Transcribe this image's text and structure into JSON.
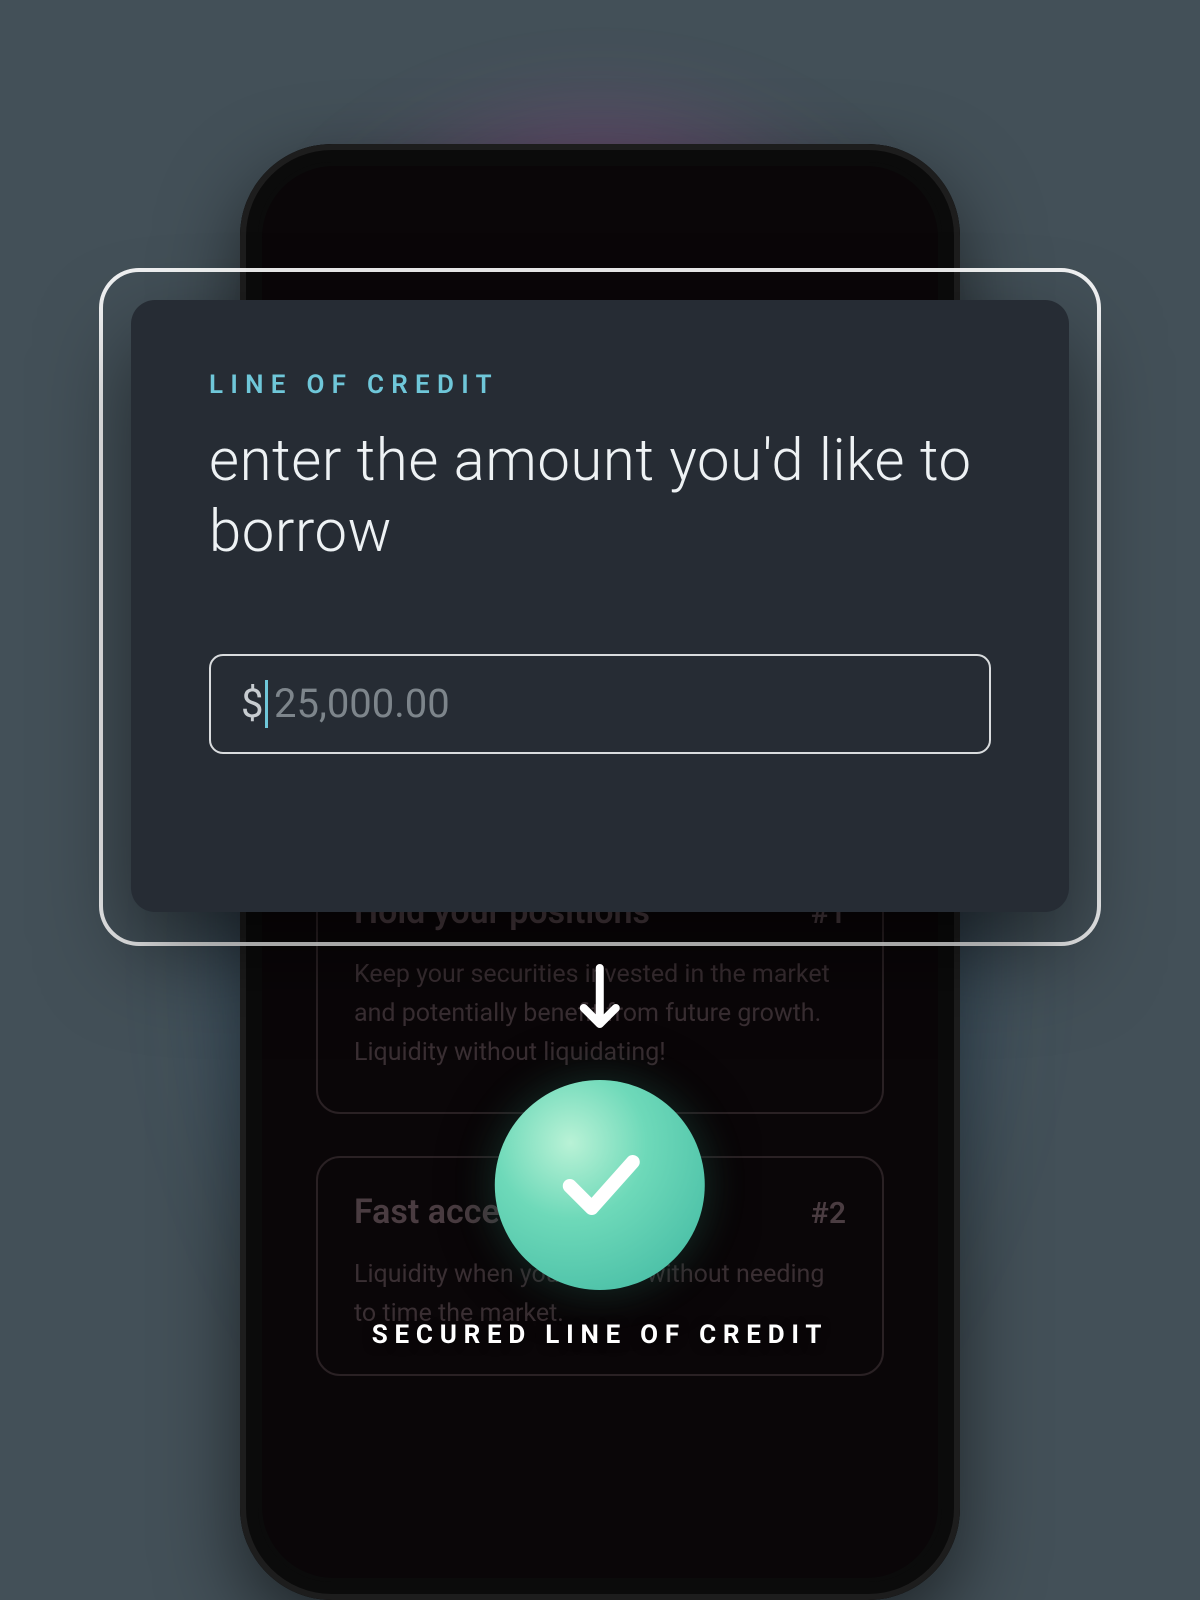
{
  "modal": {
    "eyebrow": "LINE OF CREDIT",
    "headline": "enter the amount you'd like to borrow",
    "currency_symbol": "$",
    "amount_placeholder": "25,000.00"
  },
  "confirmation": {
    "label": "SECURED LINE OF CREDIT"
  },
  "background_cards": [
    {
      "title": "Hold your positions",
      "rank": "#1",
      "body": "Keep your securities invested in the market and potentially benefit from future growth. Liquidity without liquidating!"
    },
    {
      "title": "Fast access to cash",
      "rank": "#2",
      "body": "Liquidity when you need it without needing to time the market."
    }
  ],
  "colors": {
    "accent_cyan": "#6fc7d9",
    "card_bg": "#262c34",
    "check_green": "#52c9a8"
  }
}
